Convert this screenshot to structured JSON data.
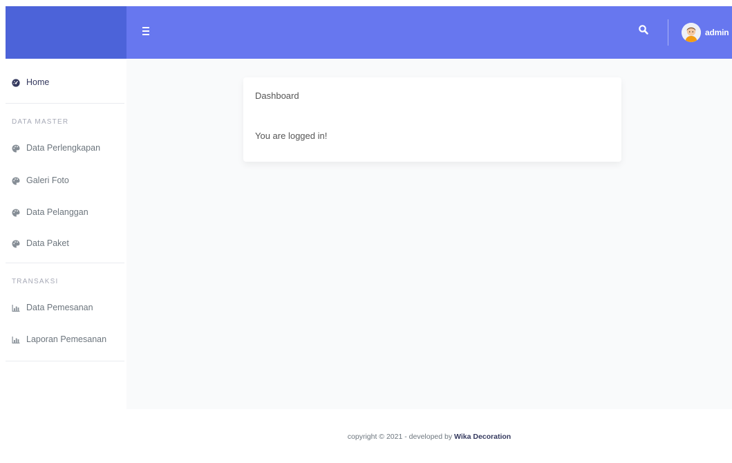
{
  "navbar": {
    "user_name": "admin",
    "brand_color": "#6777ef",
    "brand_color_dark": "#4c63d9",
    "menu_icon": "hamburger-icon",
    "search_icon": "search-icon"
  },
  "sidebar": {
    "home": {
      "label": "Home",
      "icon": "dashboard-icon"
    },
    "sections": [
      {
        "header": "DATA MASTER",
        "items": [
          {
            "label": "Data Perlengkapan",
            "icon": "palette-icon"
          },
          {
            "label": "Galeri Foto",
            "icon": "palette-icon"
          },
          {
            "label": "Data Pelanggan",
            "icon": "palette-icon"
          },
          {
            "label": "Data Paket",
            "icon": "palette-icon"
          }
        ]
      },
      {
        "header": "TRANSAKSI",
        "items": [
          {
            "label": "Data Pemesanan",
            "icon": "chart-icon"
          },
          {
            "label": "Laporan Pemesanan",
            "icon": "chart-icon"
          }
        ]
      }
    ]
  },
  "card": {
    "title": "Dashboard",
    "message": "You are logged in!"
  },
  "footer": {
    "prefix": "copyright © 2021 - developed by ",
    "brand": "Wika Decoration"
  }
}
